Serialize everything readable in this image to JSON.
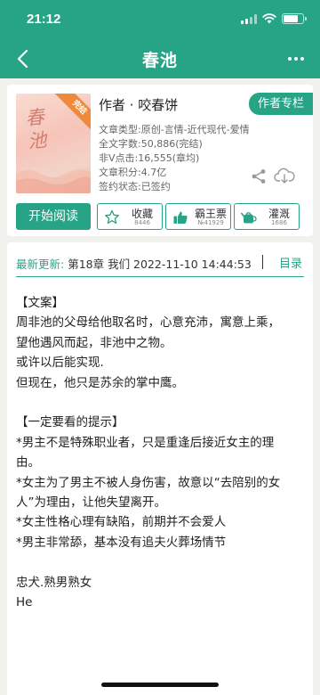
{
  "status_bar": {
    "time": "21:12"
  },
  "nav": {
    "title": "春池"
  },
  "book": {
    "cover_title": "春池",
    "badge": "完结",
    "author_line": "作者 · 咬春饼",
    "author_button": "作者专栏",
    "meta": [
      "文章类型:原创-言情-近代现代-爱情",
      "全文字数:50,886(完结)",
      "非V点击:16,555(章均)",
      "文章积分:4.7亿",
      "签约状态:已签约"
    ]
  },
  "actions": {
    "read_label": "开始阅读",
    "collect": {
      "label": "收藏",
      "count": "8446"
    },
    "ticket": {
      "label": "霸王票",
      "count": "№41929"
    },
    "water": {
      "label": "灌溉",
      "count": "1686"
    }
  },
  "update": {
    "label": "最新更新:",
    "text": "第18章 我们 2022-11-10 14:44:53",
    "toc_label": "目录"
  },
  "summary": {
    "lines": [
      "【文案】",
      "周非池的父母给他取名时，心意充沛，寓意上乘，",
      "望他遇风而起，非池中之物。",
      "或许以后能实现.",
      "但现在，他只是苏余的掌中鹰。",
      "",
      "【一定要看的提示】",
      "*男主不是特殊职业者，只是重逢后接近女主的理",
      "由。",
      "*女主为了男主不被人身伤害，故意以“去陪别的女",
      "人”为理由，让他失望离开。",
      "*女主性格心理有缺陷，前期并不会爱人",
      "*男主非常舔，基本没有追夫火葬场情节",
      "",
      "忠犬.熟男熟女",
      "He"
    ]
  },
  "colors": {
    "accent": "#27a486",
    "badge": "#ef8a3c",
    "background": "#f1f1ee"
  },
  "icons": [
    "back-arrow-icon",
    "more-icon",
    "share-icon",
    "cloud-download-icon",
    "star-icon",
    "thumbs-up-icon",
    "watering-can-icon"
  ]
}
